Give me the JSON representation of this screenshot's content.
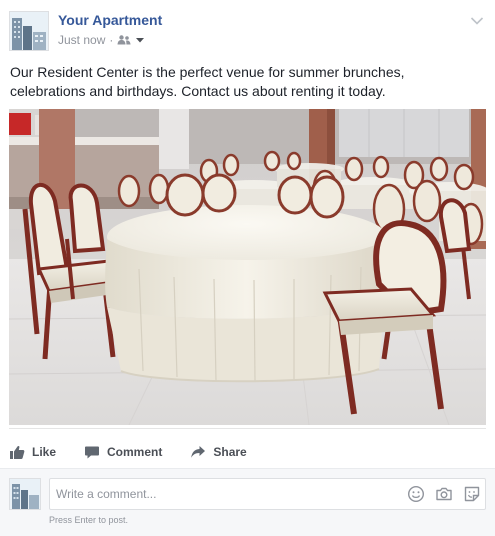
{
  "post": {
    "page_name": "Your Apartment",
    "timestamp": "Just now",
    "separator": "·",
    "text": "Our Resident Center is the perfect venue for summer brunches, celebrations and birthdays. Contact us about renting it today.",
    "audience_icon": "friends-icon",
    "menu_icon": "chevron-down-icon"
  },
  "actions": {
    "like": "Like",
    "comment": "Comment",
    "share": "Share"
  },
  "comment_box": {
    "placeholder": "Write a comment...",
    "hint": "Press Enter to post.",
    "icons": [
      "emoji-icon",
      "camera-icon",
      "sticker-icon"
    ]
  },
  "colors": {
    "link_blue": "#365899",
    "text": "#1d2129",
    "muted": "#90949c",
    "action_text": "#4b4f56"
  }
}
